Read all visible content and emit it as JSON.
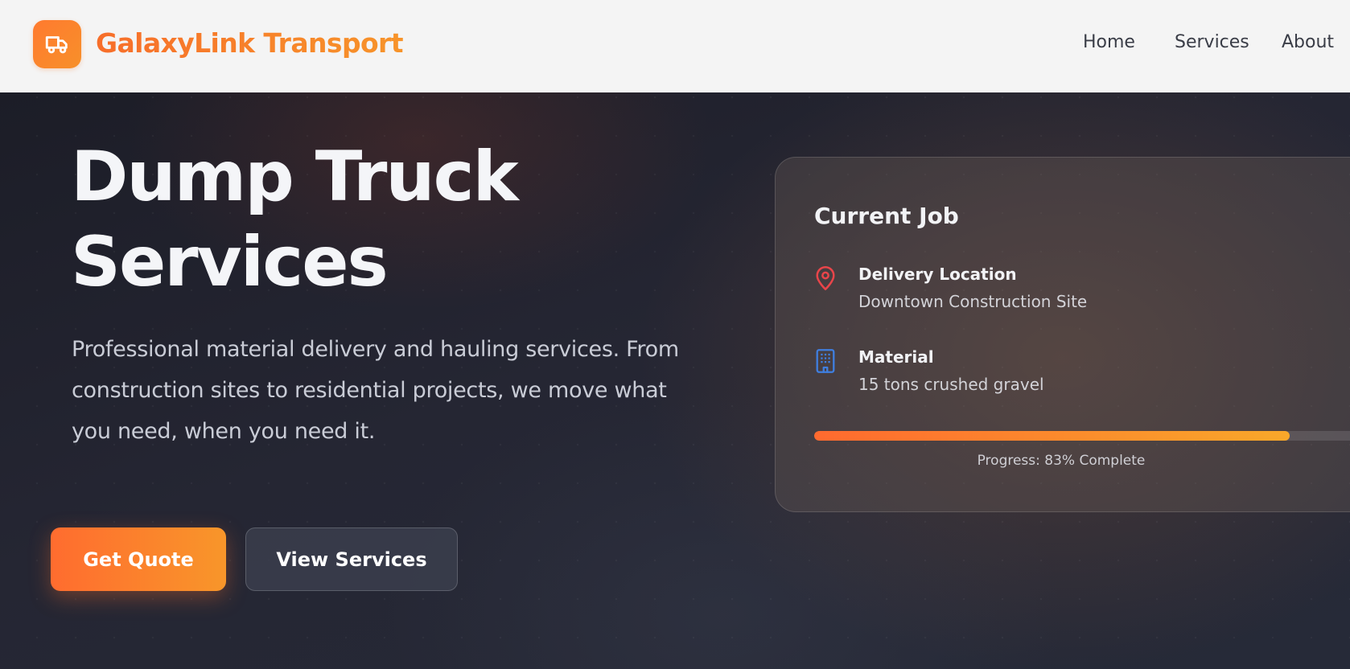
{
  "header": {
    "brand": "GalaxyLink Transport",
    "logo_icon": "truck-icon",
    "nav": [
      {
        "label": "Home"
      },
      {
        "label": "Services"
      },
      {
        "label": "About"
      }
    ]
  },
  "hero": {
    "title_line1": "Dump Truck",
    "title_line2": "Services",
    "description": "Professional material delivery and hauling services. From construction sites to residential projects, we move what you need, when you need it.",
    "primary_button": "Get Quote",
    "secondary_button": "View Services"
  },
  "job_card": {
    "title": "Current Job",
    "location": {
      "icon": "map-pin-icon",
      "label": "Delivery Location",
      "value": "Downtown Construction Site"
    },
    "material": {
      "icon": "building-icon",
      "label": "Material",
      "value": "15 tons crushed gravel"
    },
    "progress_percent": 83,
    "progress_text": "Progress: 83% Complete"
  },
  "colors": {
    "accent_start": "#ff6c2f",
    "accent_end": "#f8962a",
    "pin_icon": "#e8454a",
    "building_icon": "#3f7fe0"
  }
}
